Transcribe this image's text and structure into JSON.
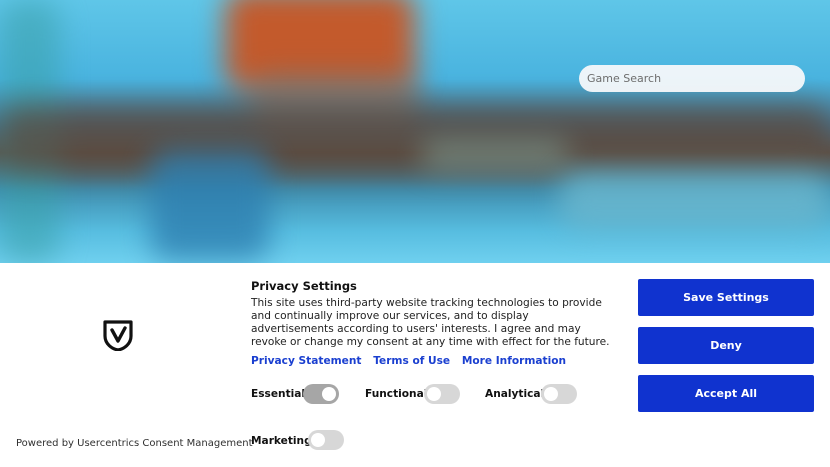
{
  "search": {
    "placeholder": "Game Search"
  },
  "consent": {
    "powered_by": "Powered by Usercentrics Consent Management",
    "title": "Privacy Settings",
    "description": "This site uses third-party website tracking technologies to provide and continually improve our services, and to display advertisements according to users' interests. I agree and may revoke or change my consent at any time with effect for the future.",
    "links": [
      "Privacy Statement",
      "Terms of Use",
      "More Information"
    ],
    "categories": [
      {
        "label": "Essential",
        "enabled": true
      },
      {
        "label": "Functional",
        "enabled": false
      },
      {
        "label": "Analytical",
        "enabled": false
      },
      {
        "label": "Marketing",
        "enabled": false
      }
    ],
    "buttons": {
      "save": "Save Settings",
      "deny": "Deny",
      "accept": "Accept All"
    }
  },
  "colors": {
    "primary_button": "#1033cf",
    "link": "#1a3fd0"
  }
}
